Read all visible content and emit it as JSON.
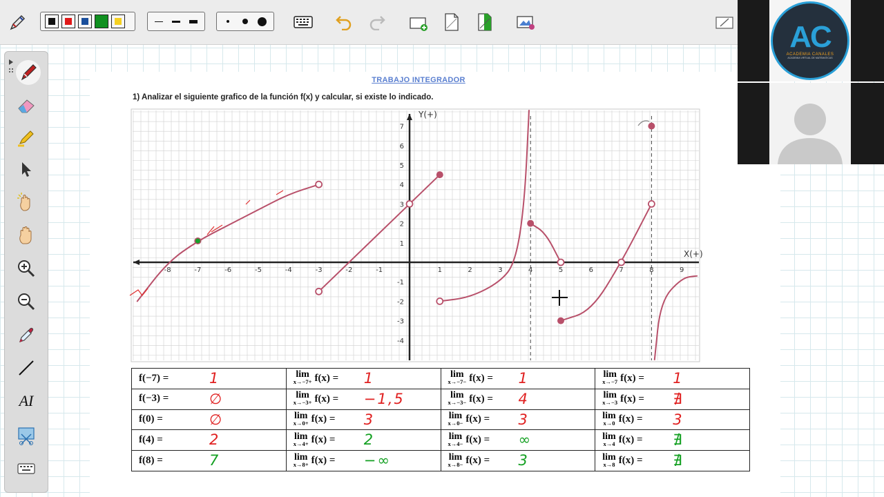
{
  "toolbar": {
    "pen_icon": "pen-tool-icon",
    "colors": [
      "#111111",
      "#e01818",
      "#1a4f9c",
      "#109020",
      "#f5d020"
    ],
    "thickness": [
      "thin",
      "medium",
      "thick"
    ],
    "dots": [
      "small",
      "medium",
      "large"
    ],
    "tools": [
      "keyboard-icon",
      "undo-icon",
      "redo-icon",
      "add-page-icon",
      "blank-page-icon",
      "green-page-icon",
      "screen-capture-icon"
    ],
    "hide_icon": "hide-toolbar-icon"
  },
  "sidebar": {
    "tools": [
      "pen-icon",
      "eraser-icon",
      "highlighter-icon",
      "pointer-icon",
      "magic-hand-icon",
      "pan-hand-icon",
      "zoom-in-icon",
      "zoom-out-icon",
      "eyedropper-icon",
      "line-icon",
      "text-icon",
      "screenshot-icon",
      "keyboard-icon"
    ],
    "text_tool_label": "AI"
  },
  "document": {
    "title": "TRABAJO INTEGRADOR",
    "question": "1) Analizar el siguiente grafico de la función f(x) y calcular, si existe lo indicado.",
    "axis_y_label": "Y(+)",
    "axis_x_label": "X(+)"
  },
  "chart_data": {
    "type": "line",
    "xlim": [
      -9,
      9.5
    ],
    "ylim": [
      -5,
      7.5
    ],
    "x_ticks": [
      "-8",
      "-7",
      "-6",
      "-5",
      "-4",
      "-3",
      "-2",
      "-1",
      "1",
      "2",
      "3",
      "4",
      "5",
      "6",
      "7",
      "8",
      "9"
    ],
    "y_ticks": [
      "7",
      "6",
      "5",
      "4",
      "3",
      "2",
      "1",
      "-1",
      "-2",
      "-3",
      "-4"
    ],
    "vertical_asymptotes": [
      4,
      8
    ],
    "series": [
      {
        "values": [
          [
            -9,
            -2
          ],
          [
            -8,
            0
          ],
          [
            -7,
            1.1
          ],
          [
            -6,
            1.9
          ],
          [
            -5,
            2.7
          ],
          [
            -4,
            3.5
          ],
          [
            -3,
            4
          ]
        ]
      },
      {
        "values": [
          [
            -3,
            -1.5
          ],
          [
            0,
            3
          ],
          [
            1,
            4.5
          ]
        ]
      },
      {
        "values": [
          [
            1,
            -2
          ],
          [
            2,
            -1.8
          ],
          [
            3,
            -1
          ],
          [
            3.5,
            0
          ],
          [
            3.8,
            3
          ],
          [
            3.95,
            8
          ]
        ]
      },
      {
        "values": [
          [
            4,
            2
          ],
          [
            4.5,
            1.5
          ],
          [
            5,
            0
          ]
        ]
      },
      {
        "values": [
          [
            5,
            -3
          ],
          [
            6,
            -2.5
          ],
          [
            7,
            0
          ],
          [
            8,
            3
          ]
        ]
      },
      {
        "values": [
          [
            8.1,
            -5
          ],
          [
            8.3,
            -2
          ],
          [
            9,
            -0.8
          ],
          [
            9.5,
            -0.7
          ]
        ]
      }
    ],
    "closed_points": [
      [
        -7,
        1.1
      ],
      [
        1,
        4.5
      ],
      [
        4,
        2
      ],
      [
        5,
        -3
      ],
      [
        8,
        7
      ]
    ],
    "open_points": [
      [
        -3,
        4
      ],
      [
        -3,
        -1.5
      ],
      [
        0,
        3
      ],
      [
        1,
        -2
      ],
      [
        5,
        0
      ],
      [
        7,
        0
      ],
      [
        8,
        3
      ]
    ]
  },
  "table": {
    "rows": [
      {
        "c1": {
          "expr": "f(−7) =",
          "ans": "1",
          "color": "red"
        },
        "c2": {
          "lim": "lim",
          "sub": "x→−7+",
          "expr": "f(x) =",
          "ans": "1",
          "color": "red"
        },
        "c3": {
          "lim": "lim",
          "sub": "x→−7−",
          "expr": "f(x) =",
          "ans": "1",
          "color": "red"
        },
        "c4": {
          "lim": "lim",
          "sub": "x→−7",
          "expr": "f(x) =",
          "ans": "1",
          "color": "red"
        }
      },
      {
        "c1": {
          "expr": "f(−3) =",
          "ans": "∅",
          "color": "red"
        },
        "c2": {
          "lim": "lim",
          "sub": "x→−3+",
          "expr": "f(x) =",
          "ans": "−1,5",
          "color": "red"
        },
        "c3": {
          "lim": "lim",
          "sub": "x→−3−",
          "expr": "f(x) =",
          "ans": "4",
          "color": "red"
        },
        "c4": {
          "lim": "lim",
          "sub": "x→−3",
          "expr": "f(x) =",
          "ans": "∄",
          "color": "red"
        }
      },
      {
        "c1": {
          "expr": "f(0) =",
          "ans": "∅",
          "color": "red"
        },
        "c2": {
          "lim": "lim",
          "sub": "x→0+",
          "expr": "f(x) =",
          "ans": "3",
          "color": "red"
        },
        "c3": {
          "lim": "lim",
          "sub": "x→0−",
          "expr": "f(x) =",
          "ans": "3",
          "color": "red"
        },
        "c4": {
          "lim": "lim",
          "sub": "x→0",
          "expr": "f(x) =",
          "ans": "3",
          "color": "red"
        }
      },
      {
        "c1": {
          "expr": "f(4) =",
          "ans": "2",
          "color": "red"
        },
        "c2": {
          "lim": "lim",
          "sub": "x→4+",
          "expr": "f(x) =",
          "ans": "2",
          "color": "green"
        },
        "c3": {
          "lim": "lim",
          "sub": "x→4−",
          "expr": "f(x) =",
          "ans": "∞",
          "color": "green"
        },
        "c4": {
          "lim": "lim",
          "sub": "x→4",
          "expr": "f(x) =",
          "ans": "∄",
          "color": "green"
        }
      },
      {
        "c1": {
          "expr": "f(8) =",
          "ans": "7",
          "color": "green"
        },
        "c2": {
          "lim": "lim",
          "sub": "x→8+",
          "expr": "f(x) =",
          "ans": "−∞",
          "color": "green"
        },
        "c3": {
          "lim": "lim",
          "sub": "x→8−",
          "expr": "f(x) =",
          "ans": "3",
          "color": "green"
        },
        "c4": {
          "lim": "lim",
          "sub": "x→8",
          "expr": "f(x) =",
          "ans": "∄",
          "color": "green"
        }
      }
    ]
  },
  "webcam": {
    "logo_letters": "AC",
    "logo_name": "ACADEMIA CANALES",
    "logo_sub": "ACADEMIA VIRTUAL DE MATEMATICAS"
  },
  "colors": {
    "curve": "#b8506a",
    "marker_fill": "#b8506a",
    "red_ink": "#e02020",
    "green_ink": "#14a022"
  }
}
